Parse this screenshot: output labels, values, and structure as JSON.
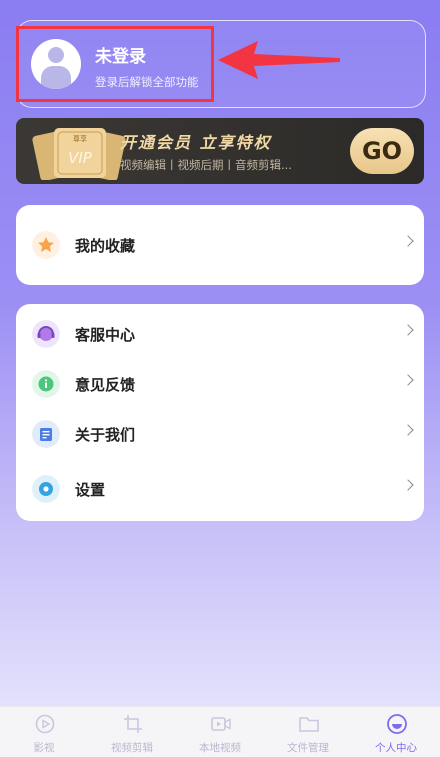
{
  "profile": {
    "name": "未登录",
    "subtitle": "登录后解锁全部功能"
  },
  "vip_banner": {
    "badge_top": "尊享",
    "badge_text": "VIP",
    "title": "开通会员 立享特权",
    "subtitle": "视频编辑丨视频后期丨音频剪辑...",
    "go_label": "GO"
  },
  "favorites": [
    {
      "label": "我的收藏",
      "icon": "star-icon"
    }
  ],
  "menu": [
    {
      "label": "客服中心",
      "icon": "headset-icon"
    },
    {
      "label": "意见反馈",
      "icon": "info-icon"
    },
    {
      "label": "关于我们",
      "icon": "document-icon"
    },
    {
      "label": "设置",
      "icon": "gear-icon"
    }
  ],
  "tabs": [
    {
      "label": "影视",
      "icon": "play-icon",
      "active": false
    },
    {
      "label": "视频剪辑",
      "icon": "crop-icon",
      "active": false
    },
    {
      "label": "本地视频",
      "icon": "video-icon",
      "active": false
    },
    {
      "label": "文件管理",
      "icon": "folder-icon",
      "active": false
    },
    {
      "label": "个人中心",
      "icon": "smile-icon",
      "active": true
    }
  ],
  "colors": {
    "accent": "#7b6cf0",
    "highlight_red": "#f23443",
    "vip_gold": "#f1d9a6"
  }
}
